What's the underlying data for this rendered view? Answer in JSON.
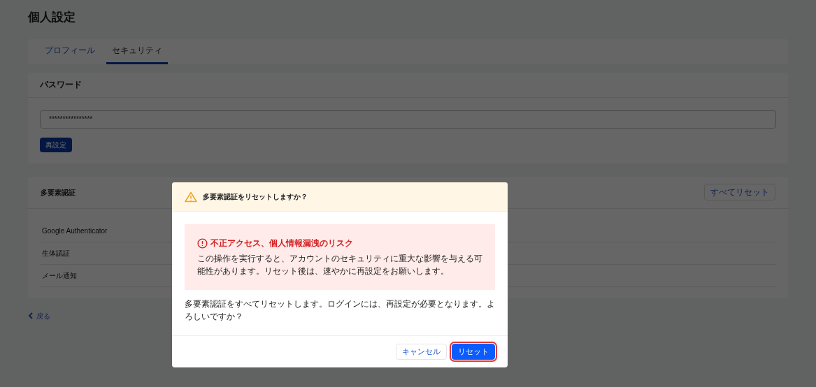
{
  "page": {
    "title": "個人設定"
  },
  "tabs": [
    {
      "label": "プロフィール",
      "selected": false
    },
    {
      "label": "セキュリティ",
      "selected": true
    }
  ],
  "password": {
    "title": "パスワード",
    "value": "****************",
    "button": "再設定"
  },
  "mfa": {
    "title": "多要素認証",
    "button": "すべてリセット",
    "items": [
      "Google Authenticator",
      "生体認証",
      "メール通知"
    ]
  },
  "back_link": "戻る",
  "dialog": {
    "title": "多要素認証をリセットしますか？",
    "alert_title": "不正アクセス、個人情報漏洩のリスク",
    "alert_text": "この操作を実行すると、アカウントのセキュリティに重大な影響を与える可能性があります。リセット後は、速やかに再設定をお願いします。",
    "message": "多要素認証をすべてリセットします。ログインには、再設定が必要となります。よろしいですか？",
    "buttons": [
      {
        "kind": "secondary",
        "label": "キャンセル",
        "highlighted": false
      },
      {
        "kind": "primary",
        "label": "リセット",
        "highlighted": true
      }
    ]
  }
}
